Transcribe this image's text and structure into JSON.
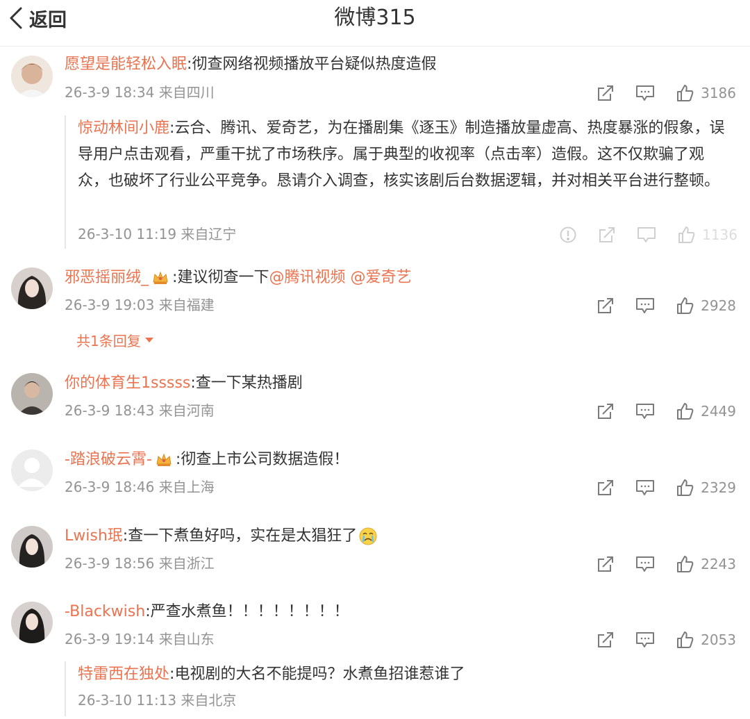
{
  "header": {
    "back_label": "返回",
    "title": "微博315"
  },
  "comments": [
    {
      "user": "愿望是能轻松入眠",
      "text": "彻查网络视频播放平台疑似热度造假",
      "time": "26-3-9 18:34",
      "location": "来自四川",
      "likes": "3186",
      "avatar_colors": [
        "#caa48a",
        "#7a4a30"
      ],
      "reply": {
        "user": "惊动林间小鹿",
        "text": "云合、腾讯、爱奇艺，为在播剧集《逐玉》制造播放量虚高、热度暴涨的假象，误导用户点击观看，严重干扰了市场秩序。属于典型的收视率（点击率）造假。这不仅欺骗了观众，也破坏了行业公平竞争。恳请介入调查，核实该剧后台数据逻辑，并对相关平台进行整顿。",
        "time": "26-3-10 11:19",
        "location": "来自辽宁",
        "likes": "1136"
      }
    },
    {
      "user": "邪恶摇丽绒_",
      "text": "建议彻查一下",
      "mentions": [
        "@腾讯视频",
        "@爱奇艺"
      ],
      "time": "26-3-9 19:03",
      "location": "来自福建",
      "likes": "2928",
      "more_replies": "共1条回复",
      "avatar_colors": [
        "#d8d0cc",
        "#2a2624"
      ]
    },
    {
      "user": "你的体育生1sssss",
      "text": "查一下某热播剧",
      "time": "26-3-9 18:43",
      "location": "来自河南",
      "likes": "2449",
      "avatar_colors": [
        "#b9b4ae",
        "#3b3836"
      ]
    },
    {
      "user": "-踏浪破云霄-",
      "text": "彻查上市公司数据造假！",
      "time": "26-3-9 18:46",
      "location": "来自上海",
      "likes": "2329",
      "avatar_colors": [
        "#ececec",
        "#ffffff"
      ]
    },
    {
      "user": "Lwish珉",
      "text": "查一下煮鱼好吗，实在是太猖狂了",
      "time": "26-3-9 18:56",
      "location": "来自浙江",
      "likes": "2243",
      "avatar_colors": [
        "#cfcac8",
        "#252222"
      ]
    },
    {
      "user": "-Blackwish",
      "text": "严查水煮鱼！！！！！！！！",
      "time": "26-3-9 19:14",
      "location": "来自山东",
      "likes": "2053",
      "avatar_colors": [
        "#d6d1cf",
        "#1e1b1b"
      ],
      "reply": {
        "user": "特雷西在独处",
        "text": "电视剧的大名不能提吗？水煮鱼招谁惹谁了",
        "time": "26-3-10 11:13",
        "location": "来自北京"
      }
    }
  ]
}
